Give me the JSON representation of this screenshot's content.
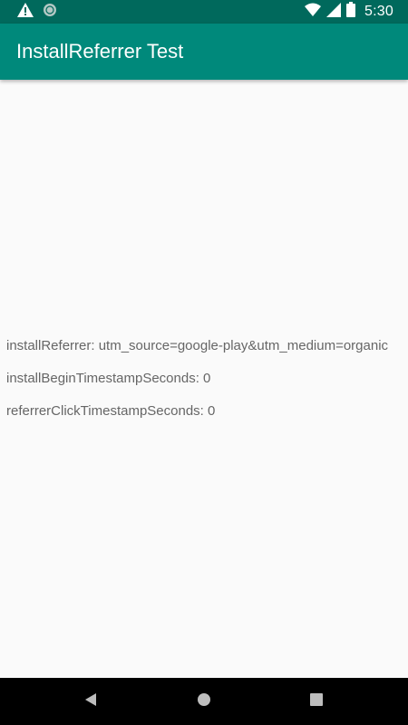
{
  "status_bar": {
    "time": "5:30",
    "left_icons": [
      "warning-icon",
      "sync-icon"
    ],
    "right_icons": [
      "wifi-icon",
      "cellular-signal-icon",
      "battery-icon"
    ]
  },
  "app_bar": {
    "title": "InstallReferrer Test",
    "color": "#00897b"
  },
  "content": {
    "lines": [
      "installReferrer: utm_source=google-play&utm_medium=organic",
      "installBeginTimestampSeconds: 0",
      "referrerClickTimestampSeconds: 0"
    ]
  },
  "nav_bar": {
    "buttons": [
      "back-icon",
      "home-icon",
      "recents-icon"
    ]
  }
}
